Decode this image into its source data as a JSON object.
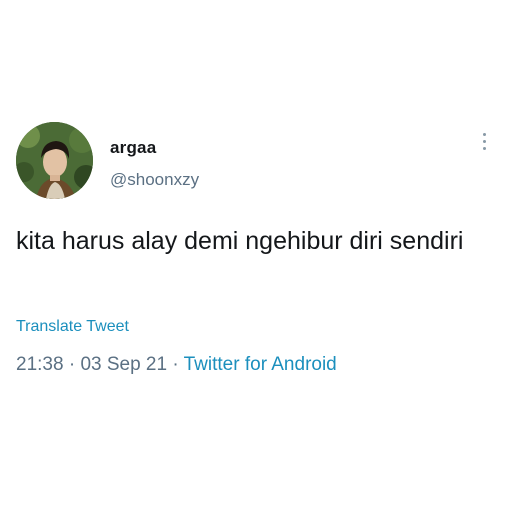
{
  "tweet": {
    "display_name": "argaa",
    "handle": "@shoonxzy",
    "text": "kita harus alay demi ngehibur diri sendiri",
    "translate_label": "Translate Tweet",
    "time": "21:38",
    "separator": "·",
    "date": "03 Sep 21",
    "source": "Twitter for Android"
  },
  "icons": {
    "more": "vertical-ellipsis-icon",
    "avatar": "profile-photo"
  },
  "colors": {
    "text": "#14171a",
    "secondary": "#5b7083",
    "link": "#1b8fbd",
    "background": "#ffffff"
  }
}
